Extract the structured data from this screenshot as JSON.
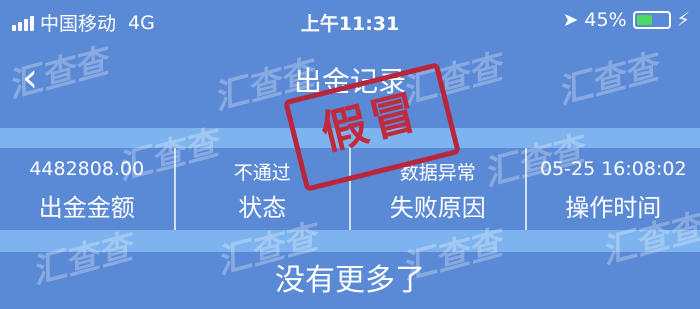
{
  "statusbar": {
    "carrier": "中国移动",
    "network": "4G",
    "time": "上午11:31",
    "location_icon": "location-arrow-icon",
    "battery_percent": "45%",
    "battery_level": 0.45,
    "charging_icon": "bolt-icon"
  },
  "navbar": {
    "back_icon": "chevron-left-icon",
    "title": "出金记录"
  },
  "record": {
    "amount": {
      "value": "4482808.00",
      "label": "出金金额"
    },
    "status": {
      "value": "不通过",
      "label": "状态"
    },
    "reason": {
      "value": "数据异常",
      "label": "失败原因"
    },
    "time": {
      "value": "05-25 16:08:02",
      "label": "操作时间"
    }
  },
  "footer": {
    "text": "没有更多了"
  },
  "stamp": {
    "text": "假冒",
    "color": "#c12a3c"
  },
  "watermark": {
    "text": "汇查查"
  },
  "colors": {
    "primary": "#5a89d6",
    "strip": "#7db3ee",
    "battery": "#4cd964"
  }
}
